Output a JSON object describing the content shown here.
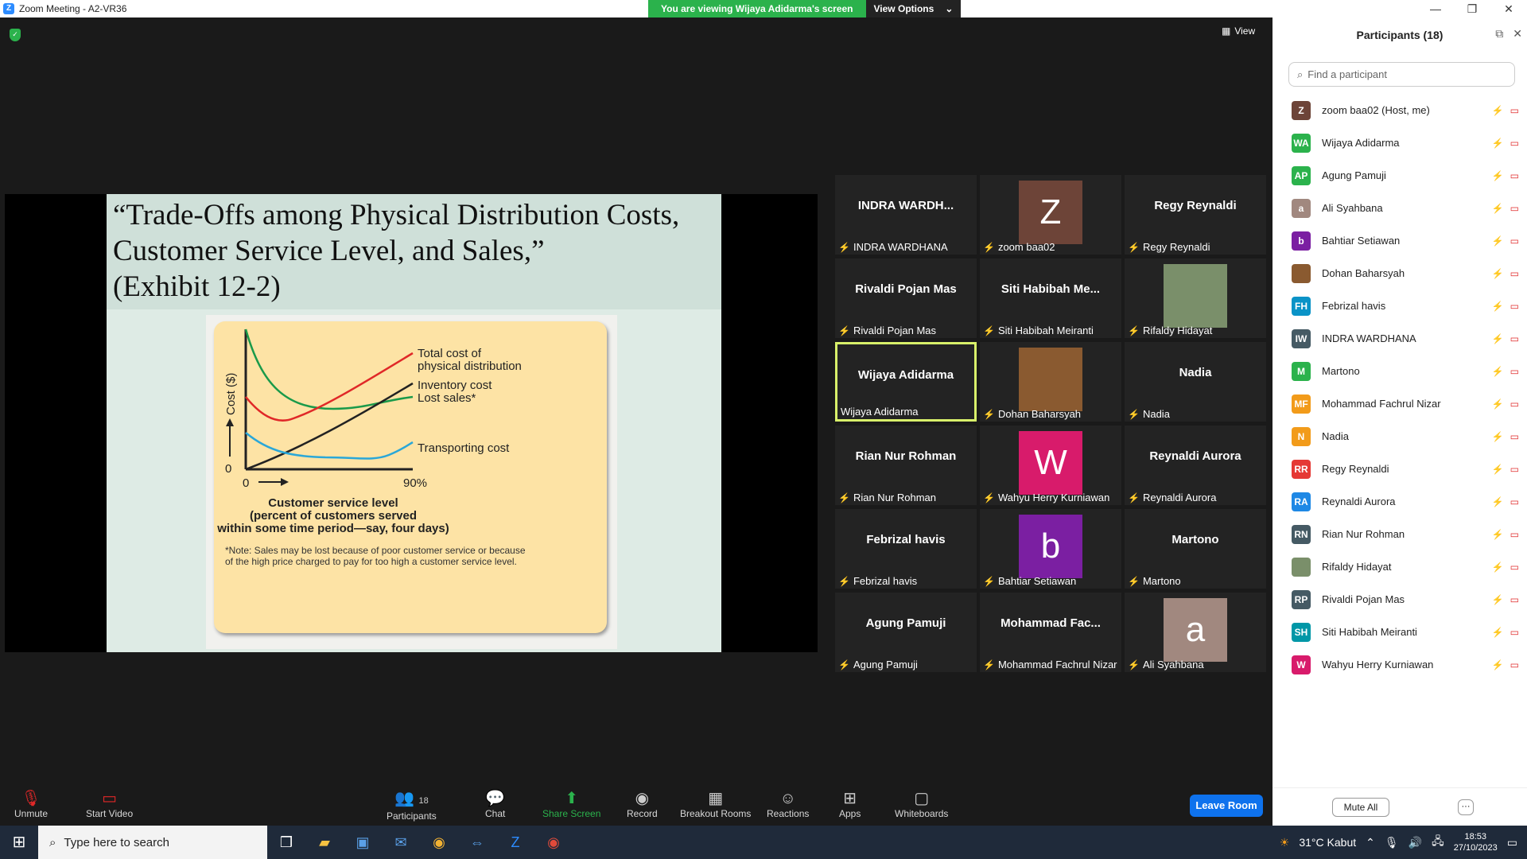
{
  "window": {
    "title": "Zoom Meeting - A2-VR36"
  },
  "banner": {
    "message": "You are viewing Wijaya Adidarma's screen",
    "options_label": "View Options"
  },
  "view_label": "View",
  "slide": {
    "title_lines": [
      "“Trade-Offs among Physical Distribution Costs,",
      "Customer Service Level, and Sales,”",
      "(Exhibit 12-2)"
    ],
    "figure": {
      "ylabel": "Cost ($)",
      "y_zero": "0",
      "x_zero": "0",
      "x_max": "90%",
      "series_total": [
        "Total cost of",
        "physical distribution"
      ],
      "series_inventory": "Inventory cost",
      "series_lost": "Lost sales*",
      "series_transport": "Transporting cost",
      "xlabel_lines": [
        "Customer service level",
        "(percent of customers served",
        "within some time period—say, four days)"
      ],
      "note_lines": [
        "*Note: Sales may be lost because of poor customer service or because",
        "of the high price charged to pay for too high a customer service level."
      ]
    }
  },
  "tiles": [
    {
      "big": "INDRA  WARDH...",
      "label": "INDRA WARDHANA",
      "avatar": "",
      "color": ""
    },
    {
      "big": "",
      "label": "zoom baa02",
      "avatar": "Z",
      "color": "#6d4438"
    },
    {
      "big": "Regy Reynaldi",
      "label": "Regy Reynaldi",
      "avatar": "",
      "color": ""
    },
    {
      "big": "Rivaldi Pojan Mas",
      "label": "Rivaldi Pojan Mas",
      "avatar": "",
      "color": ""
    },
    {
      "big": "Siti  Habibah  Me...",
      "label": "Siti Habibah Meiranti",
      "avatar": "",
      "color": ""
    },
    {
      "big": "",
      "label": "Rifaldy Hidayat",
      "avatar": "",
      "color": "#7a8f6a"
    },
    {
      "big": "Wijaya Adidarma",
      "label": "Wijaya Adidarma",
      "avatar": "",
      "color": ""
    },
    {
      "big": "",
      "label": "Dohan Baharsyah",
      "avatar": "",
      "color": "#8a5a30"
    },
    {
      "big": "Nadia",
      "label": "Nadia",
      "avatar": "",
      "color": ""
    },
    {
      "big": "Rian Nur Rohman",
      "label": "Rian Nur Rohman",
      "avatar": "",
      "color": ""
    },
    {
      "big": "",
      "label": "Wahyu Herry Kurniawan",
      "avatar": "W",
      "color": "#d81b6b"
    },
    {
      "big": "Reynaldi Aurora",
      "label": "Reynaldi Aurora",
      "avatar": "",
      "color": ""
    },
    {
      "big": "Febrizal havis",
      "label": "Febrizal havis",
      "avatar": "",
      "color": ""
    },
    {
      "big": "",
      "label": "Bahtiar Setiawan",
      "avatar": "b",
      "color": "#7b1fa2"
    },
    {
      "big": "Martono",
      "label": "Martono",
      "avatar": "",
      "color": ""
    },
    {
      "big": "Agung Pamuji",
      "label": "Agung Pamuji",
      "avatar": "",
      "color": ""
    },
    {
      "big": "Mohammad  Fac...",
      "label": "Mohammad Fachrul Nizar",
      "avatar": "",
      "color": ""
    },
    {
      "big": "",
      "label": "Ali Syahbana",
      "avatar": "a",
      "color": "#a1887f"
    }
  ],
  "participants_panel": {
    "title": "Participants (18)",
    "search_placeholder": "Find a participant",
    "mute_all": "Mute All",
    "more": "···",
    "list": [
      {
        "initials": "Z",
        "name": "zoom baa02 (Host, me)",
        "color": "#6d4438"
      },
      {
        "initials": "WA",
        "name": "Wijaya Adidarma",
        "color": "#2bb24c"
      },
      {
        "initials": "AP",
        "name": "Agung Pamuji",
        "color": "#2bb24c"
      },
      {
        "initials": "a",
        "name": "Ali Syahbana",
        "color": "#a1887f"
      },
      {
        "initials": "b",
        "name": "Bahtiar Setiawan",
        "color": "#7b1fa2"
      },
      {
        "initials": "",
        "name": "Dohan Baharsyah",
        "color": "#8a5a30"
      },
      {
        "initials": "FH",
        "name": "Febrizal havis",
        "color": "#0a93c7"
      },
      {
        "initials": "IW",
        "name": "INDRA WARDHANA",
        "color": "#455a64"
      },
      {
        "initials": "M",
        "name": "Martono",
        "color": "#2bb24c"
      },
      {
        "initials": "MF",
        "name": "Mohammad Fachrul Nizar",
        "color": "#f29b1a"
      },
      {
        "initials": "N",
        "name": "Nadia",
        "color": "#f29b1a"
      },
      {
        "initials": "RR",
        "name": "Regy Reynaldi",
        "color": "#e53935"
      },
      {
        "initials": "RA",
        "name": "Reynaldi Aurora",
        "color": "#1e88e5"
      },
      {
        "initials": "RN",
        "name": "Rian Nur Rohman",
        "color": "#455a64"
      },
      {
        "initials": "",
        "name": "Rifaldy Hidayat",
        "color": "#7a8f6a"
      },
      {
        "initials": "RP",
        "name": "Rivaldi Pojan Mas",
        "color": "#455a64"
      },
      {
        "initials": "SH",
        "name": "Siti Habibah Meiranti",
        "color": "#0097a7"
      },
      {
        "initials": "W",
        "name": "Wahyu Herry Kurniawan",
        "color": "#d81b6b"
      }
    ]
  },
  "toolbar": {
    "unmute": "Unmute",
    "start_video": "Start Video",
    "participants": "Participants",
    "participants_count": "18",
    "chat": "Chat",
    "share": "Share Screen",
    "record": "Record",
    "breakout": "Breakout Rooms",
    "reactions": "Reactions",
    "apps": "Apps",
    "whiteboards": "Whiteboards",
    "leave": "Leave Room"
  },
  "taskbar": {
    "search_placeholder": "Type here to search",
    "weather": "31°C  Kabut",
    "time": "18:53",
    "date": "27/10/2023"
  }
}
